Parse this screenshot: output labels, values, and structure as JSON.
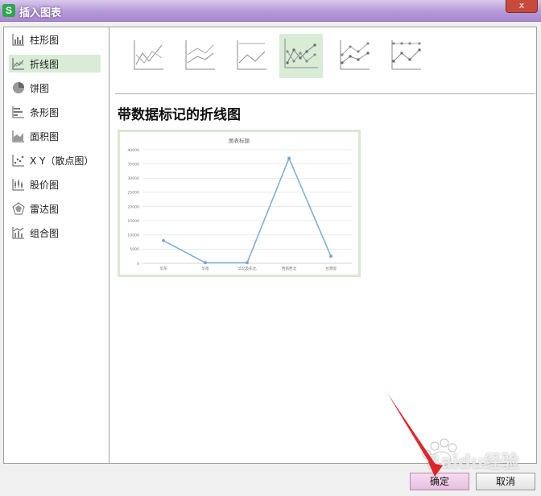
{
  "window": {
    "app_icon_letter": "S",
    "title": "插入图表",
    "close_symbol": "x"
  },
  "sidebar": {
    "items": [
      {
        "label": "柱形图",
        "icon": "column-chart-icon",
        "selected": false
      },
      {
        "label": "折线图",
        "icon": "line-chart-icon",
        "selected": true
      },
      {
        "label": "饼图",
        "icon": "pie-chart-icon",
        "selected": false
      },
      {
        "label": "条形图",
        "icon": "bar-chart-icon",
        "selected": false
      },
      {
        "label": "面积图",
        "icon": "area-chart-icon",
        "selected": false
      },
      {
        "label": "X Y（散点图）",
        "icon": "scatter-chart-icon",
        "selected": false
      },
      {
        "label": "股价图",
        "icon": "stock-chart-icon",
        "selected": false
      },
      {
        "label": "雷达图",
        "icon": "radar-chart-icon",
        "selected": false
      },
      {
        "label": "组合图",
        "icon": "combo-chart-icon",
        "selected": false
      }
    ]
  },
  "gallery": {
    "selected_index": 3,
    "thumbs": [
      {
        "icon": "line-chart-thumb-icon"
      },
      {
        "icon": "stacked-line-chart-thumb-icon"
      },
      {
        "icon": "percent-stacked-line-chart-thumb-icon"
      },
      {
        "icon": "line-with-markers-thumb-icon"
      },
      {
        "icon": "stacked-line-with-markers-thumb-icon"
      },
      {
        "icon": "percent-stacked-line-with-markers-thumb-icon"
      }
    ]
  },
  "subtype_title": "带数据标记的折线图",
  "chart_data": {
    "type": "line",
    "title": "图表标题",
    "categories": [
      "华东",
      "华南",
      "华北及东北",
      "西南西北",
      "台港澳"
    ],
    "series": [
      {
        "values": [
          8000,
          200,
          200,
          37000,
          2500
        ]
      }
    ],
    "y_ticks": [
      0,
      5000,
      10000,
      15000,
      20000,
      25000,
      30000,
      35000,
      40000
    ],
    "ylim": [
      0,
      40000
    ],
    "grid": true,
    "line_color": "#7fb0d8",
    "marker_color": "#6fa3d2"
  },
  "buttons": {
    "ok": "确定",
    "cancel": "取消"
  },
  "watermark": {
    "text": "Baidu经验"
  },
  "colors": {
    "accent_selected": "#d8ecd6",
    "titlebar": "#b49ad6",
    "arrow": "#e0252a"
  }
}
